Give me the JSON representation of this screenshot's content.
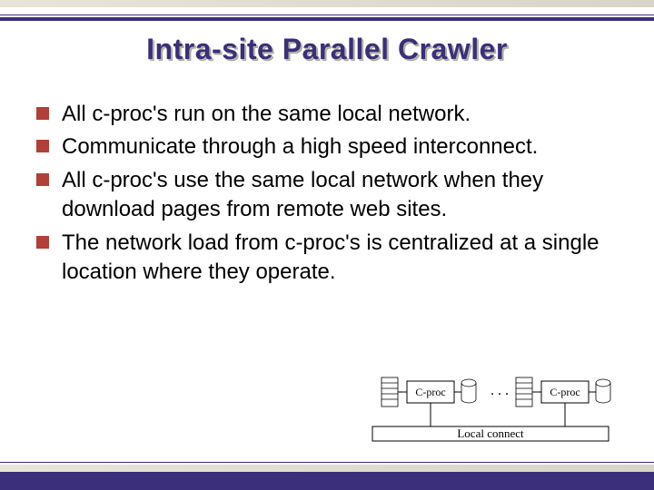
{
  "title": "Intra-site Parallel Crawler",
  "bullets": [
    "All c-proc's run on the same local network.",
    "Communicate through a high speed interconnect.",
    "All c-proc's use the same local network when they download pages from remote web sites.",
    "The network load from c-proc's is centralized at a single location where they operate."
  ],
  "diagram": {
    "box_label": "C-proc",
    "ellipsis": ". . .",
    "connect_label": "Local connect"
  }
}
